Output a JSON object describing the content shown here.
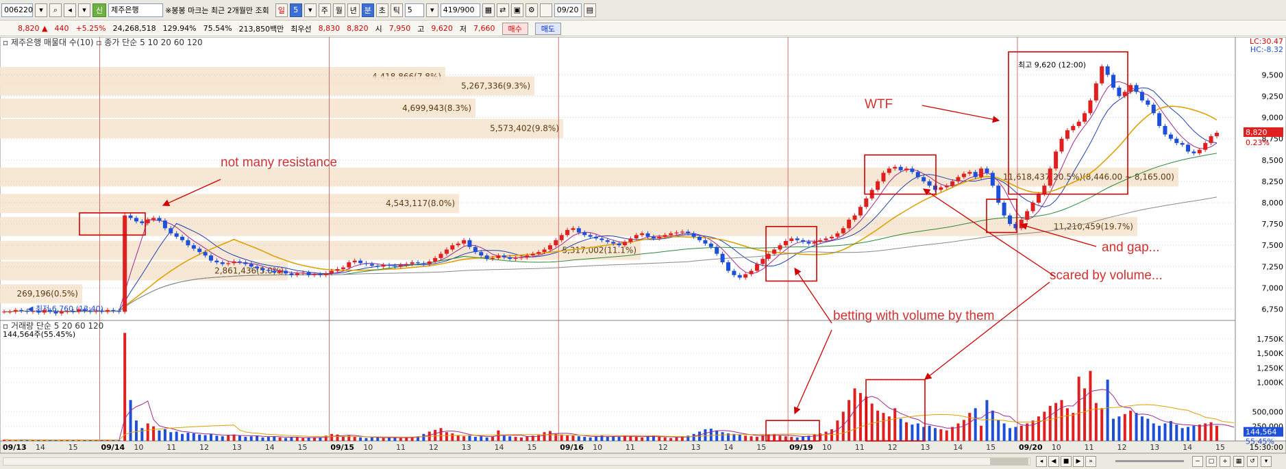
{
  "toolbar": {
    "code": "006220",
    "name": "제주은행",
    "notice": "※봉봉 마크는 최근 2개월만 조회",
    "period_buttons": [
      "일",
      "5",
      "주",
      "월",
      "년",
      "분",
      "초",
      "틱"
    ],
    "interval": "5",
    "count": "419/900",
    "date": "09/20"
  },
  "quote": {
    "price": "8,820",
    "change": "440",
    "change_pct": "+5.25%",
    "volume": "24,268,518",
    "volume_ratio": "129.94%",
    "turnover": "75.54%",
    "amount": "213,850백만",
    "best_ask_label": "최우선",
    "best_ask": "8,830",
    "best_bid": "8,820",
    "open_label": "시",
    "open": "7,950",
    "high_label": "고",
    "high": "9,620",
    "low_label": "저",
    "low": "7,660",
    "buy_btn": "매수",
    "sell_btn": "매도"
  },
  "chart_data": {
    "type": "candlestick",
    "legend_price": "제주은행 매물대 수(10)",
    "legend_ma": [
      "종가 단순 5",
      "10",
      "20",
      "60",
      "120"
    ],
    "legend_volume": [
      "거래량 단순 5",
      "20",
      "60",
      "120"
    ],
    "volume_last_label": "144,564주(55.45%)",
    "y_ticks": [
      "9,500",
      "9,250",
      "9,000",
      "8,750",
      "8,500",
      "8,250",
      "8,000",
      "7,750",
      "7,500",
      "7,250",
      "7,000",
      "6,750"
    ],
    "y_range": [
      6650,
      9800
    ],
    "vol_ticks": [
      "1,750K",
      "1,500K",
      "1,250K",
      "1,000K",
      "500,000",
      "250,000"
    ],
    "vol_range": [
      0,
      1900000
    ],
    "lc_label": "LC:30.47",
    "hc_label": "HC:-8.32",
    "price_tag": "8,820",
    "pct_tag": "0.23%",
    "vol_tag": "144,564",
    "vol_pct_tag": "55.45%",
    "x_labels": [
      "09/13",
      "14",
      "15",
      "09/14",
      "10",
      "11",
      "12",
      "13",
      "14",
      "15",
      "09/15",
      "10",
      "11",
      "12",
      "13",
      "14",
      "15",
      "09/16",
      "10",
      "11",
      "12",
      "13",
      "14",
      "15",
      "09/19",
      "10",
      "11",
      "12",
      "13",
      "14",
      "15",
      "09/20",
      "10",
      "11",
      "12",
      "13",
      "14",
      "15"
    ],
    "time_label": "15:30:00",
    "volume_profile": [
      {
        "price": 9480,
        "label": "4,418,866(7.8%)"
      },
      {
        "price": 9370,
        "label": "5,267,336(9.3%)"
      },
      {
        "price": 9110,
        "label": "4,699,943(8.3%)"
      },
      {
        "price": 8870,
        "label": "5,573,402(9.8%)"
      },
      {
        "price": 8300,
        "label": "11,618,437(20.5%)(8,446.00 ~ 8,165.00)"
      },
      {
        "price": 7990,
        "label": "4,543,117(8.0%)"
      },
      {
        "price": 7720,
        "label": "11,210,459(19.7%)"
      },
      {
        "price": 7440,
        "label": "5,317,002(11.1%)"
      },
      {
        "price": 7200,
        "label": "2,861,436(5.0%)"
      },
      {
        "price": 6930,
        "label": "269,196(0.5%)"
      }
    ],
    "hi_label": "최고 9,620 (12:00)",
    "lo_label": "최저 6,760 (13:40)",
    "prices": [
      6720,
      6720,
      6740,
      6730,
      6720,
      6730,
      6710,
      6740,
      6720,
      6700,
      6720,
      6730,
      6720,
      6750,
      6730,
      6720,
      6730,
      6720,
      6740,
      6730,
      6720,
      7850,
      7820,
      7780,
      7760,
      7800,
      7820,
      7790,
      7700,
      7640,
      7600,
      7560,
      7500,
      7460,
      7420,
      7380,
      7320,
      7300,
      7280,
      7290,
      7310,
      7300,
      7280,
      7250,
      7230,
      7210,
      7200,
      7180,
      7200,
      7170,
      7150,
      7170,
      7180,
      7150,
      7160,
      7150,
      7170,
      7200,
      7220,
      7240,
      7300,
      7320,
      7290,
      7280,
      7260,
      7250,
      7270,
      7260,
      7250,
      7270,
      7280,
      7300,
      7290,
      7280,
      7310,
      7350,
      7400,
      7450,
      7500,
      7520,
      7560,
      7480,
      7420,
      7380,
      7340,
      7350,
      7380,
      7360,
      7340,
      7350,
      7360,
      7380,
      7400,
      7420,
      7450,
      7500,
      7560,
      7620,
      7680,
      7700,
      7650,
      7620,
      7600,
      7580,
      7560,
      7540,
      7520,
      7500,
      7540,
      7580,
      7620,
      7640,
      7600,
      7580,
      7600,
      7620,
      7640,
      7650,
      7660,
      7640,
      7600,
      7560,
      7520,
      7480,
      7400,
      7300,
      7200,
      7150,
      7120,
      7160,
      7200,
      7280,
      7340,
      7400,
      7450,
      7500,
      7550,
      7580,
      7560,
      7540,
      7520,
      7540,
      7560,
      7580,
      7600,
      7640,
      7700,
      7800,
      7850,
      7950,
      8050,
      8150,
      8250,
      8350,
      8400,
      8420,
      8380,
      8400,
      8360,
      8300,
      8250,
      8200,
      8150,
      8180,
      8200,
      8250,
      8300,
      8340,
      8360,
      8300,
      8400,
      8350,
      8200,
      8000,
      7850,
      7750,
      7700,
      7800,
      7900,
      8000,
      8100,
      8200,
      8400,
      8600,
      8750,
      8850,
      8900,
      8950,
      9050,
      9200,
      9400,
      9600,
      9500,
      9350,
      9250,
      9300,
      9380,
      9300,
      9200,
      9150,
      9050,
      8900,
      8800,
      8750,
      8700,
      8680,
      8600,
      8580,
      8620,
      8700,
      8780,
      8820
    ],
    "volumes": [
      20000,
      15000,
      18000,
      22000,
      17000,
      15000,
      20000,
      16000,
      14000,
      18000,
      21000,
      19000,
      17000,
      15000,
      16000,
      18000,
      14000,
      15000,
      20000,
      18000,
      16000,
      1850000,
      700000,
      350000,
      220000,
      300000,
      250000,
      180000,
      200000,
      150000,
      160000,
      120000,
      140000,
      130000,
      110000,
      100000,
      120000,
      90000,
      80000,
      100000,
      110000,
      90000,
      70000,
      80000,
      90000,
      60000,
      70000,
      80000,
      60000,
      50000,
      70000,
      60000,
      50000,
      60000,
      55000,
      60000,
      90000,
      120000,
      110000,
      80000,
      90000,
      70000,
      60000,
      50000,
      60000,
      70000,
      50000,
      60000,
      55000,
      50000,
      60000,
      70000,
      80000,
      120000,
      160000,
      190000,
      220000,
      150000,
      130000,
      100000,
      80000,
      90000,
      70000,
      80000,
      60000,
      70000,
      180000,
      90000,
      80000,
      70000,
      60000,
      80000,
      90000,
      100000,
      150000,
      170000,
      120000,
      110000,
      100000,
      90000,
      80000,
      70000,
      60000,
      80000,
      90000,
      70000,
      80000,
      70000,
      90000,
      80000,
      70000,
      60000,
      80000,
      90000,
      70000,
      60000,
      50000,
      60000,
      80000,
      90000,
      120000,
      160000,
      200000,
      210000,
      180000,
      150000,
      130000,
      120000,
      110000,
      90000,
      80000,
      70000,
      100000,
      110000,
      120000,
      90000,
      80000,
      70000,
      60000,
      80000,
      90000,
      110000,
      130000,
      160000,
      200000,
      350000,
      500000,
      700000,
      900000,
      820000,
      760000,
      640000,
      520000,
      480000,
      420000,
      560000,
      380000,
      320000,
      280000,
      300000,
      240000,
      260000,
      220000,
      200000,
      180000,
      240000,
      300000,
      360000,
      480000,
      560000,
      260000,
      700000,
      520000,
      360000,
      300000,
      220000,
      240000,
      260000,
      300000,
      350000,
      420000,
      500000,
      600000,
      650000,
      700000,
      560000,
      480000,
      1100000,
      900000,
      1200000,
      650000,
      560000,
      1050000,
      380000,
      420000,
      460000,
      520000,
      480000,
      420000,
      380000,
      300000,
      260000,
      300000,
      340000,
      280000,
      220000,
      240000,
      260000,
      280000,
      300000,
      320000,
      260000,
      240000,
      200000,
      144564
    ],
    "annotations": [
      "not many resistance",
      "WTF",
      "and gap...",
      "scared by volume...",
      "betting with volume by them"
    ]
  }
}
